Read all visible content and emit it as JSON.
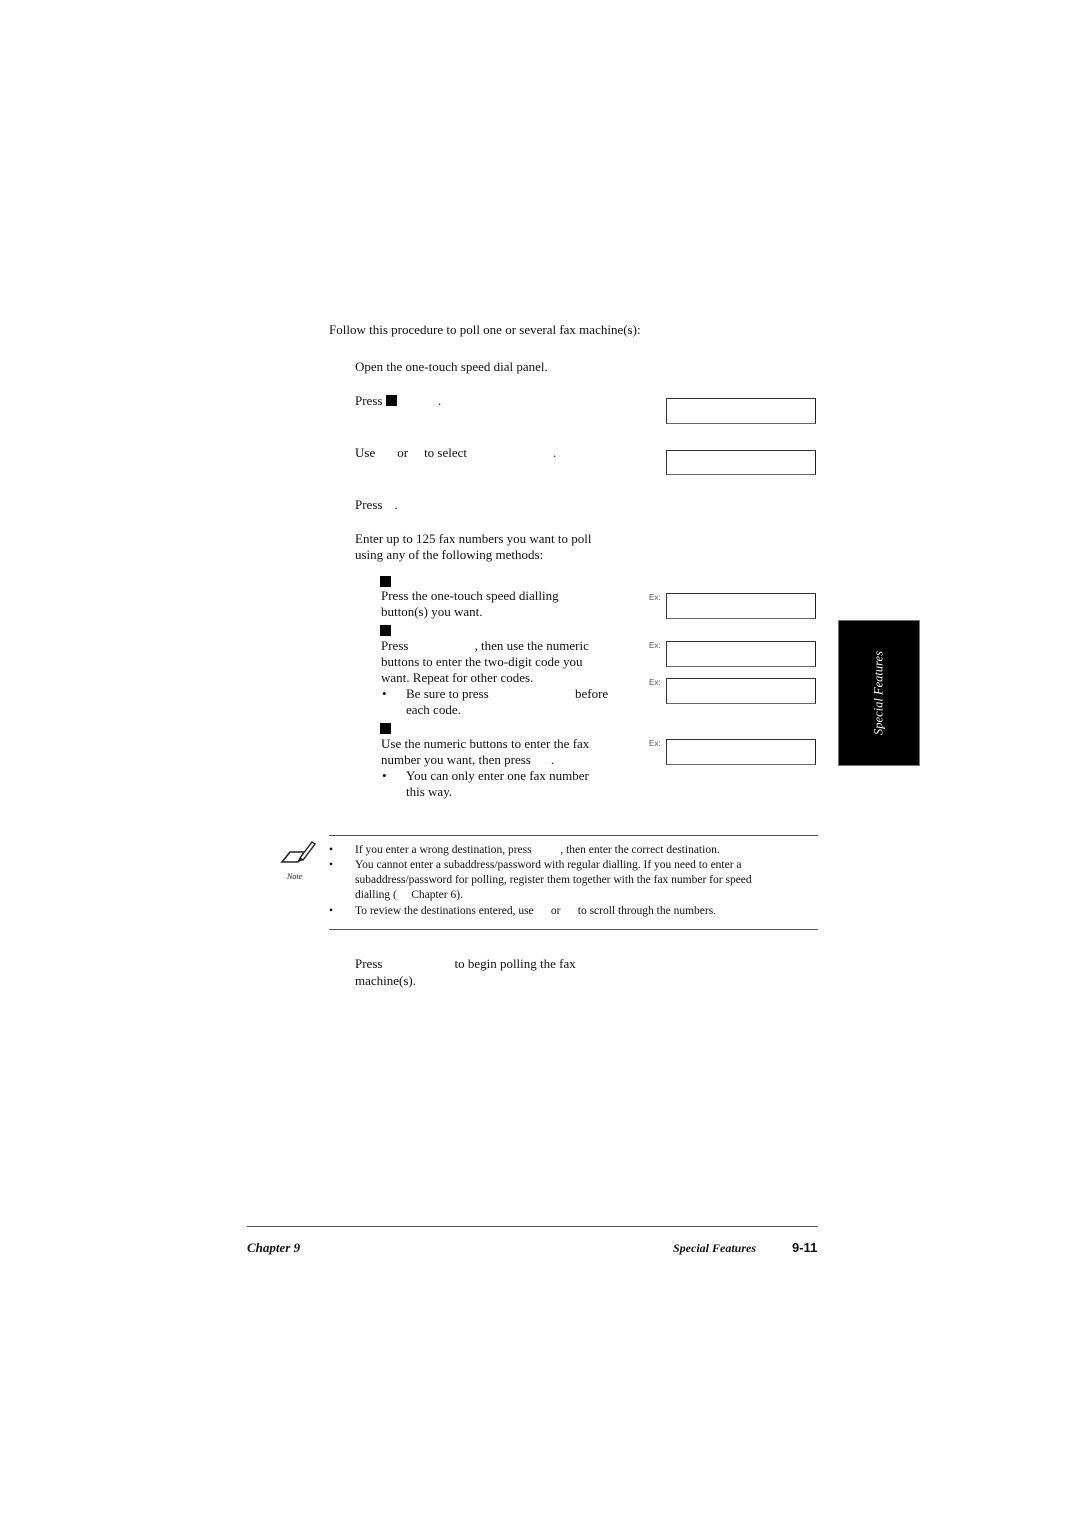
{
  "intro": "Follow this procedure to poll one or several fax machine(s):",
  "steps": {
    "s1": "Open the one-touch speed dial panel.",
    "s2_press": "Press",
    "s2_end": ".",
    "s3_use": "Use",
    "s3_or": "or",
    "s3_select": "to select",
    "s3_end": ".",
    "s4_press": "Press",
    "s4_end": ".",
    "s5_line1": "Enter up to 125 fax numbers you want to poll",
    "s5_line2": "using any of the following methods:",
    "method1": {
      "line1": "Press the one-touch speed dialling",
      "line2": "button(s) you want."
    },
    "method2": {
      "press": "Press",
      "line1_rest": ", then use the numeric",
      "line2": "buttons to enter the two-digit code you",
      "line3": "want. Repeat for other codes.",
      "bullet_a": "Be sure to press",
      "bullet_b": "before",
      "bullet_c": "each code."
    },
    "method3": {
      "line1": "Use the numeric buttons to enter the fax",
      "line2": "number you want, then press",
      "line2_end": ".",
      "bullet_a": "You can only enter one fax number",
      "bullet_b": "this way."
    },
    "s6_press": "Press",
    "s6_rest": "to begin polling the fax",
    "s6_line2": "machine(s)."
  },
  "display": {
    "ex_label": "Ex:"
  },
  "note": {
    "label": "Note",
    "bullet": "•",
    "items": [
      "If you enter a wrong destination, press          , then enter the correct destination.",
      "You cannot enter a subaddress/password with regular dialling. If you need to enter a",
      "subaddress/password for polling, register them together with the fax number for speed",
      "dialling (     Chapter 6).",
      "To review the destinations entered, use      or      to scroll through the numbers."
    ]
  },
  "side_tab": "Special Features",
  "footer": {
    "left": "Chapter 9",
    "middle": "Special Features",
    "page": "9-11"
  }
}
